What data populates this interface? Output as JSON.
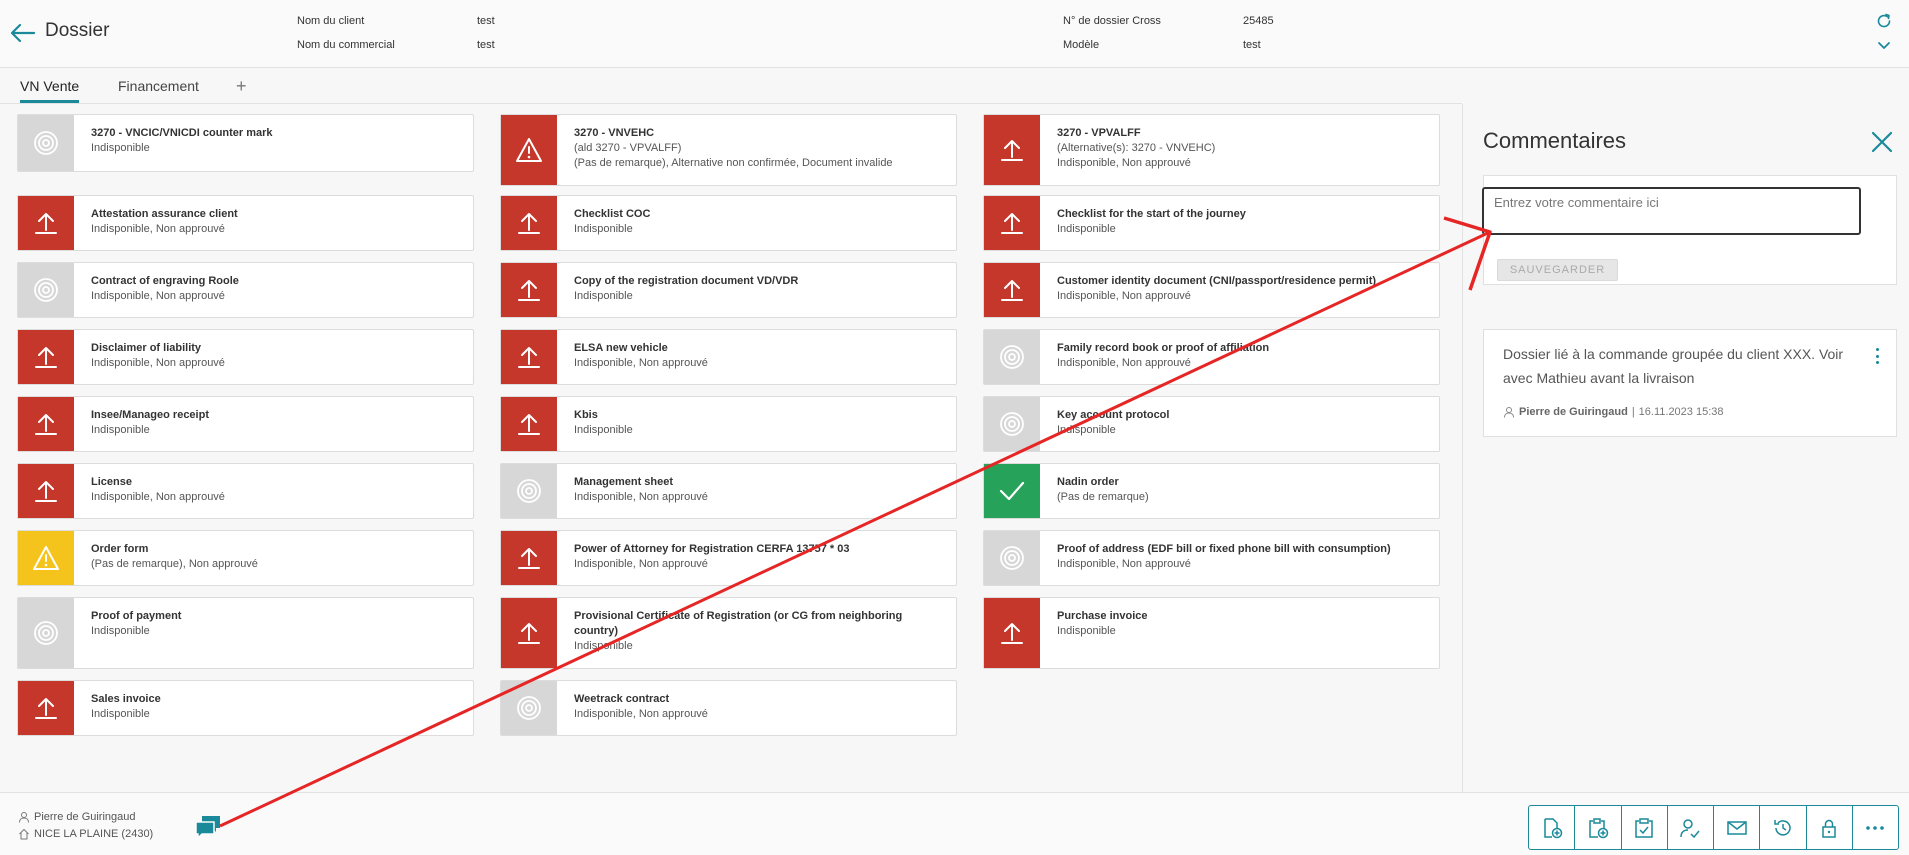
{
  "header": {
    "title": "Dossier",
    "client_label": "Nom du client",
    "client_value": "test",
    "commercial_label": "Nom du commercial",
    "commercial_value": "test",
    "dossier_label": "N° de dossier Cross",
    "dossier_value": "25485",
    "model_label": "Modèle",
    "model_value": "test"
  },
  "tabs": [
    {
      "label": "VN Vente",
      "active": true
    },
    {
      "label": "Financement",
      "active": false
    }
  ],
  "documents": [
    [
      {
        "name": "3270 - VNCIC/VNICDI counter mark",
        "lines": [
          "Indisponible"
        ],
        "icon": "target-icon",
        "color": "grey"
      },
      {
        "name": "Attestation assurance client",
        "lines": [
          "Indisponible, Non approuvé"
        ],
        "icon": "upload-icon",
        "color": "red"
      },
      {
        "name": "Contract of engraving Roole",
        "lines": [
          "Indisponible, Non approuvé"
        ],
        "icon": "target-icon",
        "color": "grey"
      },
      {
        "name": "Disclaimer of liability",
        "lines": [
          "Indisponible, Non approuvé"
        ],
        "icon": "upload-icon",
        "color": "red"
      },
      {
        "name": "Insee/Manageo receipt",
        "lines": [
          "Indisponible"
        ],
        "icon": "upload-icon",
        "color": "red"
      },
      {
        "name": "License",
        "lines": [
          "Indisponible, Non approuvé"
        ],
        "icon": "upload-icon",
        "color": "red"
      },
      {
        "name": "Order form",
        "lines": [
          "(Pas de remarque), Non approuvé"
        ],
        "icon": "warning-icon",
        "color": "yellow"
      },
      {
        "name": "Proof of payment",
        "lines": [
          "Indisponible"
        ],
        "icon": "target-icon",
        "color": "grey"
      },
      {
        "name": "Sales invoice",
        "lines": [
          "Indisponible"
        ],
        "icon": "upload-icon",
        "color": "red"
      }
    ],
    [
      {
        "name": "3270 - VNVEHC",
        "lines": [
          "(ald 3270 - VPVALFF)",
          "(Pas de remarque), Alternative non confirmée, Document invalide"
        ],
        "icon": "warning-icon",
        "color": "red"
      },
      {
        "name": "Checklist COC",
        "lines": [
          "Indisponible"
        ],
        "icon": "upload-icon",
        "color": "red"
      },
      {
        "name": "Copy of the registration document VD/VDR",
        "lines": [
          "Indisponible"
        ],
        "icon": "upload-icon",
        "color": "red"
      },
      {
        "name": "ELSA new vehicle",
        "lines": [
          "Indisponible, Non approuvé"
        ],
        "icon": "upload-icon",
        "color": "red"
      },
      {
        "name": "Kbis",
        "lines": [
          "Indisponible"
        ],
        "icon": "upload-icon",
        "color": "red"
      },
      {
        "name": "Management sheet",
        "lines": [
          "Indisponible, Non approuvé"
        ],
        "icon": "target-icon",
        "color": "grey"
      },
      {
        "name": "Power of Attorney for Registration CERFA 13757 * 03",
        "lines": [
          "Indisponible, Non approuvé"
        ],
        "icon": "upload-icon",
        "color": "red"
      },
      {
        "name": "Provisional Certificate of Registration (or CG from neighboring country)",
        "lines": [
          "Indisponible"
        ],
        "icon": "upload-icon",
        "color": "red"
      },
      {
        "name": "Weetrack contract",
        "lines": [
          "Indisponible, Non approuvé"
        ],
        "icon": "target-icon",
        "color": "grey"
      }
    ],
    [
      {
        "name": "3270 - VPVALFF",
        "lines": [
          "(Alternative(s): 3270 - VNVEHC)",
          "Indisponible, Non approuvé"
        ],
        "icon": "upload-icon",
        "color": "red"
      },
      {
        "name": "Checklist for the start of the journey",
        "lines": [
          "Indisponible"
        ],
        "icon": "upload-icon",
        "color": "red"
      },
      {
        "name": "Customer identity document (CNI/passport/residence permit)",
        "lines": [
          "Indisponible, Non approuvé"
        ],
        "icon": "upload-icon",
        "color": "red"
      },
      {
        "name": "Family record book or proof of affiliation",
        "lines": [
          "Indisponible, Non approuvé"
        ],
        "icon": "target-icon",
        "color": "grey"
      },
      {
        "name": "Key account protocol",
        "lines": [
          "Indisponible"
        ],
        "icon": "target-icon",
        "color": "grey"
      },
      {
        "name": "Nadin order",
        "lines": [
          "(Pas de remarque)"
        ],
        "icon": "check-icon",
        "color": "green"
      },
      {
        "name": "Proof of address (EDF bill or fixed phone bill with consumption)",
        "lines": [
          "Indisponible, Non approuvé"
        ],
        "icon": "target-icon",
        "color": "grey"
      },
      {
        "name": "Purchase invoice",
        "lines": [
          "Indisponible"
        ],
        "icon": "upload-icon",
        "color": "red"
      }
    ]
  ],
  "comments": {
    "title": "Commentaires",
    "placeholder": "Entrez votre commentaire ici",
    "save_label": "SAUVEGARDER",
    "items": [
      {
        "text": "Dossier lié à la commande groupée du client XXX. Voir avec Mathieu avant la livraison",
        "author": "Pierre de Guiringaud",
        "date": "16.11.2023 15:38"
      }
    ]
  },
  "footer": {
    "user": "Pierre de Guiringaud",
    "store": "NICE LA PLAINE (2430)"
  },
  "toolbar_icons": [
    "add-document-icon",
    "add-clipboard-icon",
    "clipboard-check-icon",
    "user-check-icon",
    "mail-icon",
    "history-icon",
    "lock-icon",
    "more-icon"
  ],
  "colors": {
    "accent": "#1a8a9a",
    "red": "#c4372a",
    "green": "#27a25a",
    "yellow": "#f4c41c",
    "grey": "#d7d7d7"
  }
}
